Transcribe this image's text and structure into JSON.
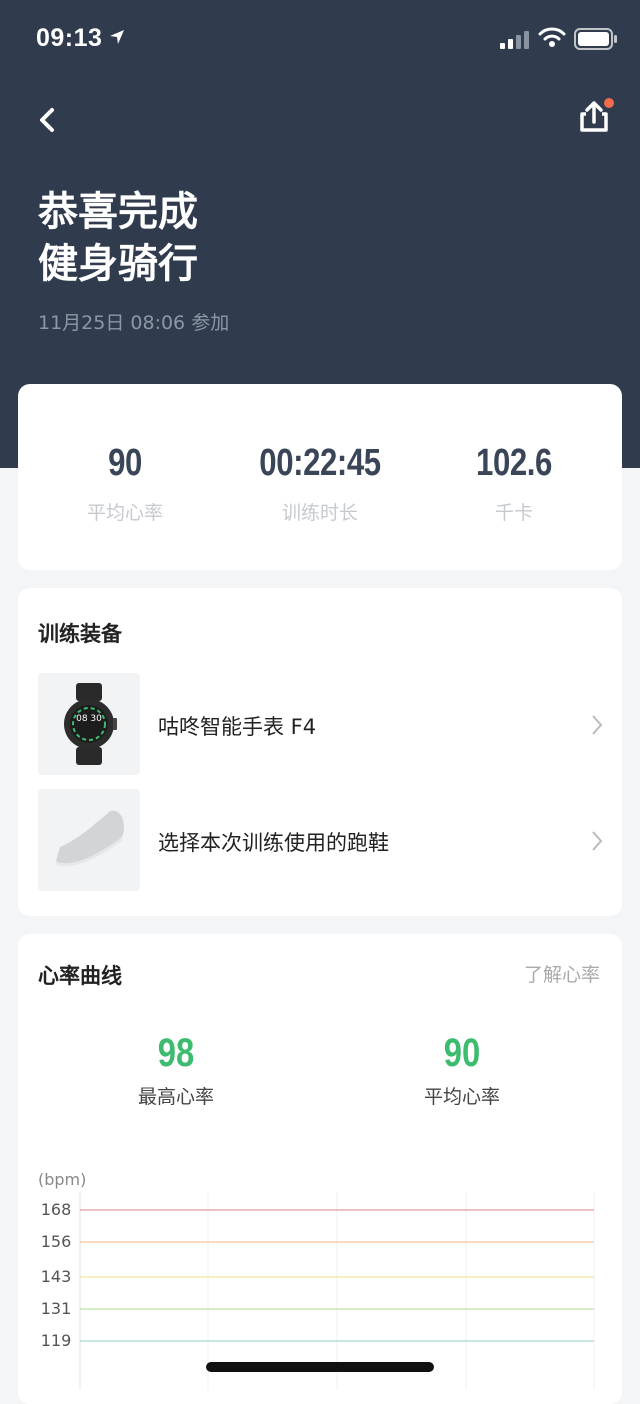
{
  "status_bar": {
    "time": "09:13"
  },
  "header": {
    "title_line1": "恭喜完成",
    "title_line2": "健身骑行",
    "subtitle": "11月25日 08:06 参加"
  },
  "stats": [
    {
      "value": "90",
      "label": "平均心率"
    },
    {
      "value": "00:22:45",
      "label": "训练时长"
    },
    {
      "value": "102.6",
      "label": "千卡"
    }
  ],
  "gear": {
    "title": "训练装备",
    "items": [
      {
        "label": "咕咚智能手表 F4",
        "icon": "smartwatch-icon",
        "watch_face_text": "08 30"
      },
      {
        "label": "选择本次训练使用的跑鞋",
        "icon": "running-shoe-icon"
      }
    ]
  },
  "heart_rate": {
    "title": "心率曲线",
    "link": "了解心率",
    "max_value": "98",
    "max_label": "最高心率",
    "avg_value": "90",
    "avg_label": "平均心率",
    "unit": "(bpm)",
    "zones": [
      {
        "value": "168",
        "color": "#e89a9a"
      },
      {
        "value": "156",
        "color": "#f0c4a0"
      },
      {
        "value": "143",
        "color": "#efe3a4"
      },
      {
        "value": "131",
        "color": "#bfe3a6"
      },
      {
        "value": "119",
        "color": "#a8d8d0"
      }
    ]
  },
  "colors": {
    "header_bg": "#303c4e",
    "accent_green": "#3dbb6f",
    "notification_dot": "#f06c4d"
  }
}
